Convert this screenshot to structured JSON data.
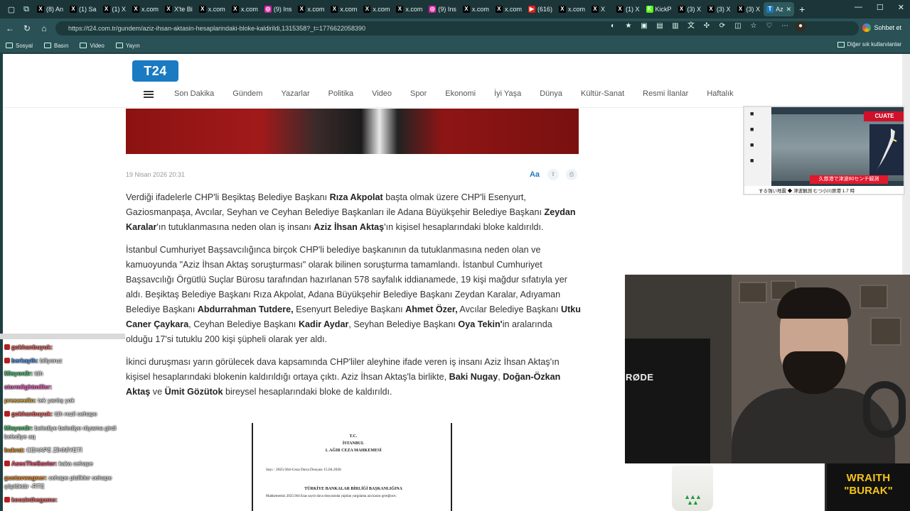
{
  "browser": {
    "tabs": [
      {
        "label": "(8) An",
        "icon": "x-logo",
        "color": "#000000"
      },
      {
        "label": "(1) Sa",
        "icon": "x-logo",
        "color": "#000000"
      },
      {
        "label": "(1) X",
        "icon": "x-logo",
        "color": "#000000"
      },
      {
        "label": "x.com",
        "icon": "x-logo",
        "color": "#000000"
      },
      {
        "label": "X'te Bi",
        "icon": "x-logo",
        "color": "#000000"
      },
      {
        "label": "x.com",
        "icon": "x-logo",
        "color": "#000000"
      },
      {
        "label": "x.com",
        "icon": "x-logo",
        "color": "#000000"
      },
      {
        "label": "(9) Ins",
        "icon": "instagram-logo",
        "color": "#d6249f"
      },
      {
        "label": "x.com",
        "icon": "x-logo",
        "color": "#000000"
      },
      {
        "label": "x.com",
        "icon": "x-logo",
        "color": "#000000"
      },
      {
        "label": "x.com",
        "icon": "x-logo",
        "color": "#000000"
      },
      {
        "label": "x.com",
        "icon": "x-logo",
        "color": "#000000"
      },
      {
        "label": "(9) Ins",
        "icon": "instagram-logo",
        "color": "#d6249f"
      },
      {
        "label": "x.com",
        "icon": "x-logo",
        "color": "#000000"
      },
      {
        "label": "x.com",
        "icon": "x-logo",
        "color": "#000000"
      },
      {
        "label": "(616)",
        "icon": "youtube-logo",
        "color": "#e62117"
      },
      {
        "label": "x.com",
        "icon": "x-logo",
        "color": "#000000"
      },
      {
        "label": "X",
        "icon": "x-logo",
        "color": "#000000"
      },
      {
        "label": "(1) X",
        "icon": "x-logo",
        "color": "#000000"
      },
      {
        "label": "KickP",
        "icon": "kick-logo",
        "color": "#53fc18"
      },
      {
        "label": "(3) X",
        "icon": "x-logo",
        "color": "#000000"
      },
      {
        "label": "(3) X",
        "icon": "x-logo",
        "color": "#000000"
      },
      {
        "label": "(3) X",
        "icon": "x-logo",
        "color": "#000000"
      },
      {
        "label": "Az",
        "icon": "t24-logo",
        "color": "#1a7ac2",
        "active": true
      }
    ],
    "url": "https://t24.com.tr/gundem/aziz-ihsan-aktasin-hesaplarindaki-bloke-kaldirildi,1315358?_t=1776622058390",
    "chat_button": "Sohbet et",
    "bookmarks": [
      "Sosyal",
      "Basın",
      "Video",
      "Yayın"
    ],
    "other_bookmarks": "Diğer sık kullanılanlar"
  },
  "site": {
    "logo": "T24",
    "nav": [
      "Son Dakika",
      "Gündem",
      "Yazarlar",
      "Politika",
      "Video",
      "Spor",
      "Ekonomi",
      "İyi Yaşa",
      "Dünya",
      "Kültür-Sanat",
      "Resmi İlanlar",
      "Haftalık"
    ]
  },
  "article": {
    "date": "19 Nisan 2026 20:31",
    "font_tool": "Aa",
    "p1": {
      "a": "Verdiği ifadelerle CHP'li Beşiktaş Belediye Başkanı ",
      "b1": "Rıza Akpolat",
      "c": " başta olmak üzere CHP'li Esenyurt, Gaziosmanpaşa, Avcılar, Seyhan ve Ceyhan Belediye Başkanları ile Adana Büyükşehir Belediye Başkanı ",
      "b2": "Zeydan Karalar",
      "d": "'ın tutuklanmasına neden olan iş insanı ",
      "b3": "Aziz İhsan Aktaş",
      "e": "'ın kişisel hesaplarındaki bloke kaldırıldı."
    },
    "p2": {
      "a": "İstanbul Cumhuriyet Başsavcılığınca birçok CHP'li belediye başkanının da tutuklanmasına neden olan ve kamuoyunda \"Aziz İhsan Aktaş soruşturması\" olarak bilinen soruşturma tamamlandı. İstanbul Cumhuriyet Başsavcılığı Örgütlü Suçlar Bürosu tarafından hazırlanan 578 sayfalık iddianamede, 19 kişi mağdur sıfatıyla yer aldı. Beşiktaş Belediye Başkanı Rıza Akpolat, Adana Büyükşehir Belediye Başkanı Zeydan Karalar, Adıyaman Belediye Başkanı ",
      "b1": "Abdurrahman Tutdere,",
      "c": " Esenyurt Belediye Başkanı ",
      "b2": "Ahmet Özer,",
      "d": " Avcılar Belediye Başkanı ",
      "b3": "Utku Caner Çaykara",
      "e": ", Ceyhan Belediye Başkanı ",
      "b4": "Kadir Aydar",
      "f": ", Seyhan Belediye Başkanı ",
      "b5": "Oya Tekin'",
      "g": "in aralarında olduğu 17'si tutuklu 200 kişi şüpheli olarak yer aldı."
    },
    "p3": {
      "a": "İkinci duruşması yarın görülecek dava kapsamında CHP'liler aleyhine ifade veren iş insanı Aziz İhsan Aktaş'ın kişisel hesaplarındaki blokenin kaldırıldığı ortaya çıktı. Aziz İhsan Aktaş'la birlikte, ",
      "b1": "Baki Nugay",
      "c": ", ",
      "b2": "Doğan-Özkan Aktaş",
      "d": " ve ",
      "b3": "Ümit Gözütok",
      "e": " bireysel hesaplarındaki bloke de kaldırıldı."
    },
    "document": {
      "line1": "T.C.",
      "line2": "İSTANBUL",
      "line3": "1. AĞIR CEZA MAHKEMESİ",
      "sayi": "Sayı   : 2025/364-Ceza Dava Dosyası   15.04.2026",
      "recipient": "TÜRKİYE BANKALAR BİRLİĞİ BAŞKANLIĞINA",
      "body": "Mahkememiz 2025/364 Esas sayılı dava dosyasında yapılan yargılama ara kararı gereğince;"
    }
  },
  "chat": [
    {
      "user": "gokhanbuyuk:",
      "msg": "",
      "color": "#ff6a6a",
      "badge": true
    },
    {
      "user": "berkayih:",
      "msg": "biliyoruz",
      "color": "#5aa0ff",
      "badge": true
    },
    {
      "user": "Misyon3r:",
      "msg": "tüh",
      "color": "#52d17a",
      "badge": false
    },
    {
      "user": "stormlightmiller:",
      "msg": "",
      "color": "#ff66cc",
      "badge": false
    },
    {
      "user": "preseeelin:",
      "msg": "tek yanlış yok",
      "color": "#f0c050",
      "badge": false
    },
    {
      "user": "gokhanbuyuk:",
      "msg": "tüh rezil cehape",
      "color": "#ff6a6a",
      "badge": true
    },
    {
      "user": "Misyon3r:",
      "msg": "belediye belediye rüyama girdi belediye aq",
      "color": "#52d17a",
      "badge": false
    },
    {
      "user": "bukrat:",
      "msg": "CEHAPE ZİHNİYETİ",
      "color": "#f0a030",
      "badge": false
    },
    {
      "user": "AsecTheSavior:",
      "msg": "kaka cehape",
      "color": "#ff5577",
      "badge": true
    },
    {
      "user": "gustavwagner:",
      "msg": "cehape pislikler cehape çöplüktür -RTE",
      "color": "#ff9a3a",
      "badge": false
    },
    {
      "user": "koozinthegame:",
      "msg": "",
      "color": "#ff6a6a",
      "badge": true
    }
  ],
  "tv": {
    "tag": "CUATE",
    "alert": "久慈港で津波80センチ観測",
    "bottom": "する強い地震   ◆ 津波観測  むつ小川原港 1.7 時"
  },
  "overlay": {
    "brand_line1": "WRAITH",
    "brand_line2": "\"BURAK\"",
    "mic_brand": "RØDE"
  }
}
